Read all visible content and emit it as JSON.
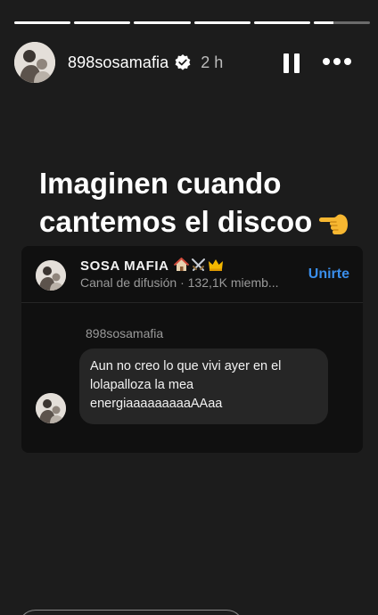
{
  "story": {
    "segments": 6,
    "current_segment_progress": 0.35
  },
  "header": {
    "username": "898sosamafia",
    "time": "2 h",
    "avatar_icon": "user-avatar-photo",
    "verified_icon": "verified-badge-icon"
  },
  "caption": {
    "line1": "Imaginen cuando",
    "line2": "cantemos el discoo",
    "emoji_icon": "backhand-pointing-left-emoji"
  },
  "card": {
    "channel_name": "SOSA MAFIA",
    "channel_emojis": [
      "house-emoji",
      "crossed-swords-emoji",
      "crown-emoji"
    ],
    "channel_sub": "Canal de difusión · 132,1K miemb...",
    "join_label": "Unirte",
    "sender": "898sosamafia",
    "message": "Aun no creo lo que vivi ayer en el lolapalloza la mea energiaaaaaaaaaAAaa"
  },
  "colors": {
    "background": "#1c1c1c",
    "card": "#101010",
    "bubble": "#262626",
    "accent": "#3a8eea"
  }
}
